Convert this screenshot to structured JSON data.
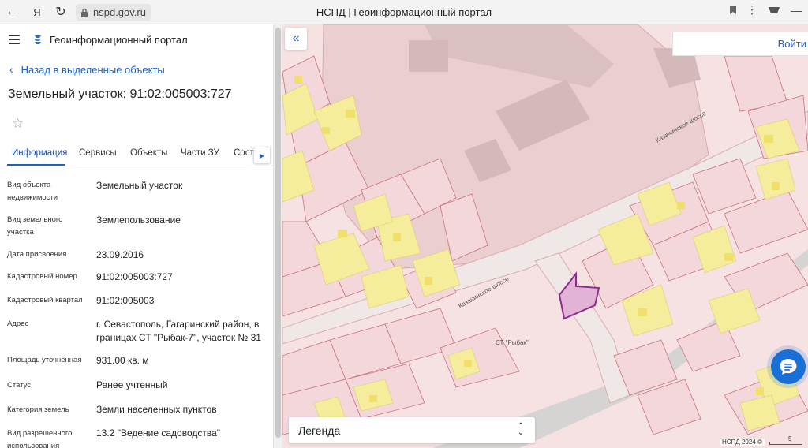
{
  "browser": {
    "url": "nspd.gov.ru",
    "title": "НСПД | Геоинформационный портал"
  },
  "app": {
    "name": "Геоинформационный портал"
  },
  "panel": {
    "back_label": "Назад в выделенные объекты",
    "object_title": "Земельный участок: 91:02:005003:727",
    "tabs": [
      "Информация",
      "Сервисы",
      "Объекты",
      "Части ЗУ",
      "Соста"
    ],
    "rows": [
      {
        "label": "Вид объекта недвижимости",
        "value": "Земельный участок"
      },
      {
        "label": "Вид земельного участка",
        "value": "Землепользование"
      },
      {
        "label": "Дата присвоения",
        "value": "23.09.2016"
      },
      {
        "label": "Кадастровый номер",
        "value": "91:02:005003:727"
      },
      {
        "label": "Кадастровый квартал",
        "value": "91:02:005003"
      },
      {
        "label": "Адрес",
        "value": "г. Севастополь, Гагаринский район, в границах СТ \"Рыбак-7\", участок № 31"
      },
      {
        "label": "Площадь уточненная",
        "value": "931.00 кв. м"
      },
      {
        "label": "Статус",
        "value": "Ранее учтенный"
      },
      {
        "label": "Категория земель",
        "value": "Земли населенных пунктов"
      },
      {
        "label": "Вид разрешенного использования",
        "value": "13.2 \"Ведение садоводства\""
      }
    ]
  },
  "map": {
    "login_label": "Войти",
    "legend_label": "Легенда",
    "copyright": "НСПД 2024 ©",
    "scale_label": "5",
    "road_label_1": "Казачинское шоссе",
    "road_label_2": "Казачинское шоссе",
    "area_label": "СТ \"Рыбак\"",
    "colors": {
      "parcel_fill": "#f4d7da",
      "parcel_border": "#c9737b",
      "building_fill": "#f5ec9c",
      "selected_fill": "#e3b3d6",
      "selected_border": "#8e2c8e",
      "accent": "#1f5fbf"
    }
  }
}
